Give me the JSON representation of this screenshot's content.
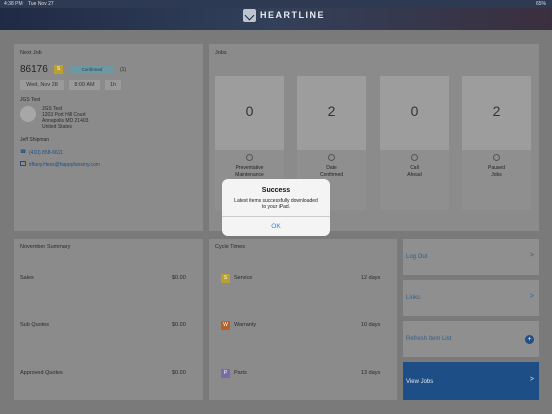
{
  "status_bar": {
    "time": "4:38 PM",
    "date": "Tue Nov 27",
    "battery": "65%"
  },
  "app": {
    "brand": "HEARTLINE"
  },
  "next_job": {
    "title": "Next Job",
    "number": "86176",
    "badge": "S",
    "status": "Confirmed",
    "count": "(1)",
    "date": "Wed, Nov 28",
    "time": "8:00 AM",
    "duration": "1h",
    "customer": "JGS Test",
    "address_lines": [
      "JGS Test",
      "1203 Port Hill Court",
      "Annapolis MD 21403",
      "United States"
    ],
    "contact_name": "Jeff Shipman",
    "phone": "(410) 858-6611",
    "email": "tiffany.Hess@happyfunsmy.com"
  },
  "jobs": {
    "title": "Jobs",
    "cards": [
      {
        "count": "0",
        "label": "Preventative\nMaintenance"
      },
      {
        "count": "2",
        "label": "Date\nConfirmed"
      },
      {
        "count": "0",
        "label": "Call\nAhead"
      },
      {
        "count": "2",
        "label": "Paused\nJobs"
      }
    ]
  },
  "summary": {
    "title": "November Summary",
    "rows": [
      {
        "label": "Sales",
        "value": "$0.00"
      },
      {
        "label": "Sub Quotes",
        "value": "$0.00"
      },
      {
        "label": "Approved Quotes",
        "value": "$0.00"
      }
    ]
  },
  "cycle_times": {
    "title": "Cycle Times",
    "rows": [
      {
        "badge": "S",
        "label": "Service",
        "value": "12 days",
        "color": "#b9a031"
      },
      {
        "badge": "W",
        "label": "Warranty",
        "value": "10 days",
        "color": "#b5622c"
      },
      {
        "badge": "P",
        "label": "Parts",
        "value": "13 days",
        "color": "#7a6aa6"
      }
    ]
  },
  "side": {
    "log_out": "Log Out",
    "links": "Links",
    "refresh": "Refresh Item List",
    "view_jobs": "View Jobs",
    "chevron": ">",
    "plus": "+"
  },
  "dialog": {
    "title": "Success",
    "message": "Latest items successfully downloaded\nto your iPad.",
    "ok": "OK"
  }
}
